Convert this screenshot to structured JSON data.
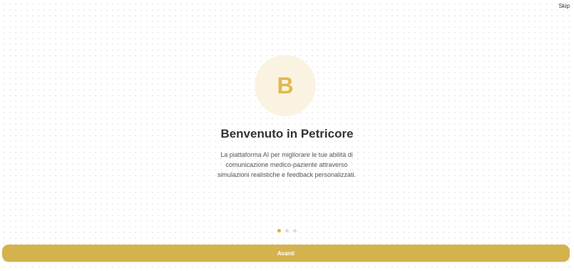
{
  "header": {
    "skip_label": "Skip"
  },
  "hero": {
    "avatar_letter": "B",
    "title": "Benvenuto in Petricore",
    "description": "La piattaforma AI per migliorare le tue abilità di comunicazione medico-paziente attraverso simulazioni realistiche e feedback personalizzati."
  },
  "pagination": {
    "total": 3,
    "current": 1
  },
  "footer": {
    "next_label": "Avanti"
  },
  "colors": {
    "accent": "#d4b34c",
    "avatar_bg": "#fbf3e1",
    "avatar_letter": "#e0b94f",
    "inactive_dot": "#dddddd"
  }
}
